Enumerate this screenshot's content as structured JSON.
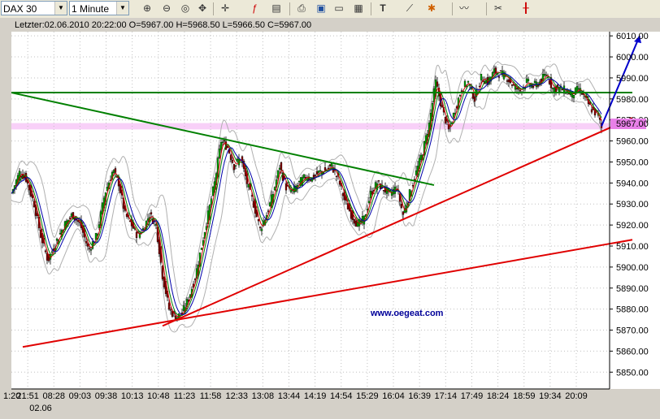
{
  "toolbar": {
    "symbol": "DAX 30",
    "interval": "1 Minute",
    "icons": [
      "zoom-in-icon",
      "zoom-out-icon",
      "zoom-fit-icon",
      "scroll-icon",
      "crosshair-icon",
      "function-icon",
      "indicator-icon",
      "chart-settings-icon",
      "print-icon",
      "save-icon",
      "export-icon",
      "text-tool-icon",
      "line-tool-icon",
      "marker-tool-icon",
      "draw-tool-icon",
      "tools-icon",
      "candle-style-icon"
    ]
  },
  "chart_data": {
    "type": "candlestick",
    "info_line": "Letzter:02.06.2010 20:22:00 O=5967.00 H=5968.50 L=5966.50 C=5967.00",
    "watermark": "www.oegeat.com",
    "ylim": [
      5842,
      6012
    ],
    "y_ticks": [
      5850,
      5860,
      5870,
      5880,
      5890,
      5900,
      5910,
      5920,
      5930,
      5940,
      5950,
      5960,
      5970,
      5980,
      5990,
      6000,
      6010
    ],
    "x_ticks": [
      "1:20",
      "21:51",
      "08:28",
      "09:03",
      "09:38",
      "10:13",
      "10:48",
      "11:23",
      "11:58",
      "12:33",
      "13:08",
      "13:44",
      "14:19",
      "14:54",
      "15:29",
      "16:04",
      "16:39",
      "17:14",
      "17:49",
      "18:24",
      "18:59",
      "19:34",
      "20:09"
    ],
    "x_sublabel": "02.06",
    "last_price": "5967.00",
    "last_price_value": 5967,
    "price_path": [
      [
        0,
        5935
      ],
      [
        10,
        5945
      ],
      [
        18,
        5942
      ],
      [
        28,
        5930
      ],
      [
        36,
        5915
      ],
      [
        45,
        5903
      ],
      [
        55,
        5912
      ],
      [
        65,
        5920
      ],
      [
        75,
        5925
      ],
      [
        85,
        5920
      ],
      [
        95,
        5908
      ],
      [
        105,
        5915
      ],
      [
        115,
        5935
      ],
      [
        125,
        5946
      ],
      [
        132,
        5940
      ],
      [
        140,
        5925
      ],
      [
        148,
        5920
      ],
      [
        155,
        5915
      ],
      [
        162,
        5918
      ],
      [
        170,
        5925
      ],
      [
        178,
        5920
      ],
      [
        186,
        5896
      ],
      [
        194,
        5880
      ],
      [
        202,
        5876
      ],
      [
        210,
        5878
      ],
      [
        218,
        5885
      ],
      [
        226,
        5895
      ],
      [
        234,
        5910
      ],
      [
        242,
        5925
      ],
      [
        250,
        5940
      ],
      [
        258,
        5960
      ],
      [
        266,
        5957
      ],
      [
        274,
        5948
      ],
      [
        282,
        5952
      ],
      [
        290,
        5940
      ],
      [
        298,
        5930
      ],
      [
        306,
        5918
      ],
      [
        314,
        5925
      ],
      [
        322,
        5935
      ],
      [
        330,
        5948
      ],
      [
        338,
        5938
      ],
      [
        346,
        5936
      ],
      [
        354,
        5940
      ],
      [
        362,
        5943
      ],
      [
        370,
        5942
      ],
      [
        378,
        5945
      ],
      [
        386,
        5946
      ],
      [
        394,
        5948
      ],
      [
        402,
        5942
      ],
      [
        410,
        5932
      ],
      [
        418,
        5925
      ],
      [
        426,
        5920
      ],
      [
        434,
        5923
      ],
      [
        442,
        5935
      ],
      [
        450,
        5940
      ],
      [
        458,
        5937
      ],
      [
        466,
        5935
      ],
      [
        474,
        5938
      ],
      [
        482,
        5925
      ],
      [
        490,
        5935
      ],
      [
        498,
        5945
      ],
      [
        506,
        5955
      ],
      [
        514,
        5968
      ],
      [
        522,
        5988
      ],
      [
        530,
        5975
      ],
      [
        538,
        5965
      ],
      [
        546,
        5975
      ],
      [
        554,
        5985
      ],
      [
        562,
        5988
      ],
      [
        570,
        5980
      ],
      [
        578,
        5990
      ],
      [
        586,
        5988
      ],
      [
        594,
        5993
      ],
      [
        602,
        5992
      ],
      [
        610,
        5990
      ],
      [
        618,
        5986
      ],
      [
        626,
        5984
      ],
      [
        634,
        5988
      ],
      [
        642,
        5986
      ],
      [
        650,
        5988
      ],
      [
        658,
        5992
      ],
      [
        666,
        5985
      ],
      [
        674,
        5985
      ],
      [
        682,
        5984
      ],
      [
        690,
        5982
      ],
      [
        698,
        5985
      ],
      [
        706,
        5980
      ],
      [
        714,
        5975
      ],
      [
        722,
        5972
      ],
      [
        726,
        5966
      ]
    ],
    "trendlines": [
      {
        "name": "green-resistance-upper",
        "color": "#008000",
        "p1": [
          0,
          5983
        ],
        "p2": [
          764,
          5983
        ]
      },
      {
        "name": "green-resistance-lower",
        "color": "#008000",
        "p1": [
          0,
          5983
        ],
        "p2": [
          520,
          5939
        ]
      },
      {
        "name": "red-support-steep",
        "color": "#e00000",
        "p1": [
          186,
          5872
        ],
        "p2": [
          764,
          5971
        ]
      },
      {
        "name": "red-support-shallow",
        "color": "#e00000",
        "p1": [
          14,
          5862
        ],
        "p2": [
          764,
          5913
        ]
      },
      {
        "name": "blue-forecast",
        "color": "#0000cc",
        "p1": [
          726,
          5967
        ],
        "p2": [
          773,
          6010
        ]
      }
    ],
    "colors": {
      "up": "#00a000",
      "down": "#800000",
      "panel_bg": "#ffffff",
      "highlight": "#f8d0f8",
      "grid": "#c0c0c0"
    }
  }
}
